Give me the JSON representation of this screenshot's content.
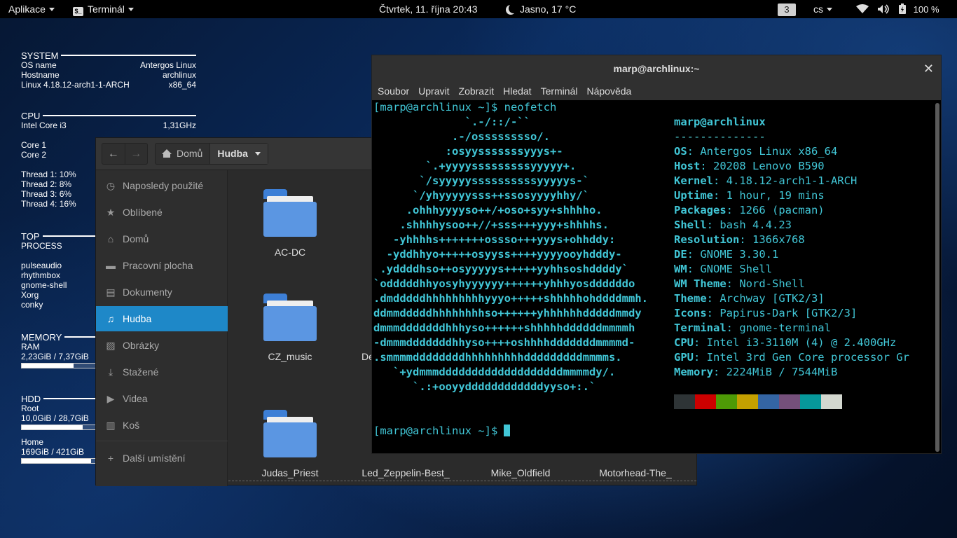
{
  "topbar": {
    "apps": "Aplikace",
    "terminal_app": "Terminál",
    "terminal_icon_glyph": "$_",
    "datetime": "Čtvrtek, 11. října  20:43",
    "weather": "Jasno, 17 °C",
    "workspace": "3",
    "keyboard": "cs",
    "battery": "100 %"
  },
  "conky": {
    "system_title": "SYSTEM",
    "os_label": "OS name",
    "os_value": "Antergos Linux",
    "host_label": "Hostname",
    "host_value": "archlinux",
    "kernel_label": "Linux 4.18.12-arch1-1-ARCH",
    "kernel_value": "x86_64",
    "cpu_title": "CPU",
    "cpu_model": "Intel Core i3",
    "cpu_freq": "1,31GHz",
    "cores": [
      "Core 1",
      "Core 2"
    ],
    "threads": [
      "Thread 1: 10%",
      "Thread 2: 8%",
      "Thread 3: 6%",
      "Thread 4: 16%"
    ],
    "top_title": "TOP",
    "process_label": "PROCESS",
    "processes": [
      "pulseaudio",
      "rhythmbox",
      "gnome-shell",
      "Xorg",
      "conky"
    ],
    "memory_title": "MEMORY",
    "ram_label": "RAM",
    "ram_value": "2,23GiB / 7,37GiB",
    "ram_fraction": 0.3,
    "hdd_title": "HDD",
    "root_label": "Root",
    "root_value": "10,0GiB / 28,7GiB",
    "root_fraction": 0.35,
    "home_label": "Home",
    "home_value": "169GiB / 421GiB",
    "home_fraction": 0.4
  },
  "files": {
    "crumb_home": "Domů",
    "crumb_current": "Hudba",
    "sidebar": [
      {
        "label": "Naposledy použité",
        "icon": "clock-icon",
        "glyph": "◷"
      },
      {
        "label": "Oblíbené",
        "icon": "star-icon",
        "glyph": "★"
      },
      {
        "label": "Domů",
        "icon": "home-icon",
        "glyph": "⌂"
      },
      {
        "label": "Pracovní plocha",
        "icon": "desktop-icon",
        "glyph": "▬"
      },
      {
        "label": "Dokumenty",
        "icon": "document-icon",
        "glyph": "▤"
      },
      {
        "label": "Hudba",
        "icon": "music-icon",
        "glyph": "♫"
      },
      {
        "label": "Obrázky",
        "icon": "image-icon",
        "glyph": "▨"
      },
      {
        "label": "Stažené",
        "icon": "download-icon",
        "glyph": "⤓"
      },
      {
        "label": "Videa",
        "icon": "video-icon",
        "glyph": "▶"
      },
      {
        "label": "Koš",
        "icon": "trash-icon",
        "glyph": "▥"
      },
      {
        "label": "Další umístění",
        "icon": "plus-icon",
        "glyph": "+"
      }
    ],
    "folders": [
      "AC-DC",
      "CZ_music",
      "De",
      "Judas_Priest",
      "Led_Zeppelin-Best_",
      "Mike_Oldfield",
      "Motorhead-The_"
    ]
  },
  "terminal": {
    "title": "marp@archlinux:~",
    "menu": [
      "Soubor",
      "Upravit",
      "Zobrazit",
      "Hledat",
      "Terminál",
      "Nápověda"
    ],
    "prompt_cmd": "[marp@archlinux ~]$ neofetch",
    "prompt_end": "[marp@archlinux ~]$",
    "logo": [
      "              `.-/::/-``",
      "            .-/osssssssso/.",
      "           :osyysssssssyyys+-",
      "        `.+yyyysssssssssyyyyy+.",
      "       `/syyyyyssssssssssyyyyys-`",
      "      `/yhyyyyysss++ssosyyyyhhy/`",
      "     .ohhhyyyyso++/+oso+syy+shhhho.",
      "    .shhhhysoo++//+sss+++yyy+shhhhs.",
      "   -yhhhhs+++++++ossso+++yyys+ohhddy:",
      "  -yddhhyo+++++osyyss++++yyyyooyhdddy-",
      " .yddddhso++osyyyyys+++++yyhhsoshddddy`",
      "`odddddhhyosyhyyyyyy++++++yhhhyosddddddo",
      ".dmdddddhhhhhhhhhyyyo+++++shhhhhohddddmmh.",
      "ddmmdddddhhhhhhhhso++++++yhhhhhhdddddmmdy",
      "dmmmdddddddhhhyso++++++shhhhhddddddmmmmh",
      "-dmmmdddddddhhyso++++oshhhhdddddddmmmmd-",
      ".smmmmddddddddhhhhhhhhhdddddddddmmmms.",
      "   `+ydmmmdddddddddddddddddddmmmmdy/.",
      "      `.:+ooyyddddddddddddyyso+:.`"
    ],
    "user_host": "marp@archlinux",
    "separator": "--------------",
    "info": [
      {
        "key": "OS",
        "value": "Antergos Linux x86_64"
      },
      {
        "key": "Host",
        "value": "20208 Lenovo B590"
      },
      {
        "key": "Kernel",
        "value": "4.18.12-arch1-1-ARCH"
      },
      {
        "key": "Uptime",
        "value": "1 hour, 19 mins"
      },
      {
        "key": "Packages",
        "value": "1266 (pacman)"
      },
      {
        "key": "Shell",
        "value": "bash 4.4.23"
      },
      {
        "key": "Resolution",
        "value": "1366x768"
      },
      {
        "key": "DE",
        "value": "GNOME 3.30.1"
      },
      {
        "key": "WM",
        "value": "GNOME Shell"
      },
      {
        "key": "WM Theme",
        "value": "Nord-Shell"
      },
      {
        "key": "Theme",
        "value": "Archway [GTK2/3]"
      },
      {
        "key": "Icons",
        "value": "Papirus-Dark [GTK2/3]"
      },
      {
        "key": "Terminal",
        "value": "gnome-terminal"
      },
      {
        "key": "CPU",
        "value": "Intel i3-3110M (4) @ 2.400GHz"
      },
      {
        "key": "GPU",
        "value": "Intel 3rd Gen Core processor Gr"
      },
      {
        "key": "Memory",
        "value": "2224MiB / 7544MiB"
      }
    ],
    "palette": [
      "#2e3436",
      "#cc0000",
      "#4e9a06",
      "#c4a000",
      "#3465a4",
      "#75507b",
      "#06989a",
      "#d3d7cf"
    ]
  }
}
